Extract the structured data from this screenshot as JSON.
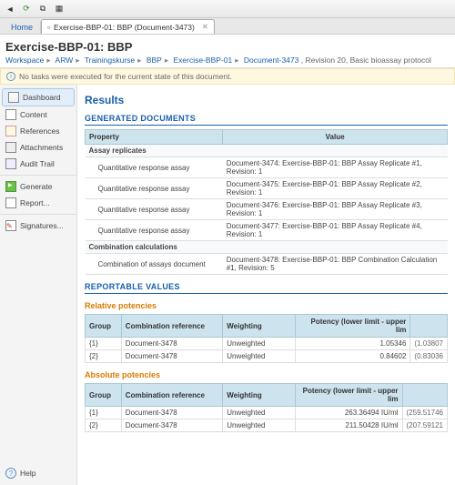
{
  "toolbar": {
    "home_label": "Home"
  },
  "tab": {
    "label": "Exercise-BBP-01: BBP (Document-3473)"
  },
  "header": {
    "title": "Exercise-BBP-01: BBP",
    "crumbs": [
      "Workspace",
      "ARW",
      "Trainingskurse",
      "BBP",
      "Exercise-BBP-01",
      "Document-3473"
    ],
    "revision": "Revision 20, Basic bioassay protocol"
  },
  "info": {
    "msg": "No tasks were executed for the current state of this document."
  },
  "sidebar": {
    "items": [
      "Dashboard",
      "Content",
      "References",
      "Attachments",
      "Audit Trail"
    ],
    "actions": [
      "Generate",
      "Report..."
    ],
    "sign": "Signatures...",
    "help": "Help"
  },
  "results": {
    "title": "Results",
    "gen_heading": "GENERATED DOCUMENTS",
    "prop_col": "Property",
    "val_col": "Value",
    "assay_label": "Assay replicates",
    "qra_label": "Quantitative response assay",
    "qra_rows": [
      "Document-3474: Exercise-BBP-01: BBP Assay Replicate #1, Revision: 1",
      "Document-3475: Exercise-BBP-01: BBP Assay Replicate #2, Revision: 1",
      "Document-3476: Exercise-BBP-01: BBP Assay Replicate #3, Revision: 1",
      "Document-3477: Exercise-BBP-01: BBP Assay Replicate #4, Revision: 1"
    ],
    "comb_label": "Combination calculations",
    "combdoc_label": "Combination of assays document",
    "combdoc_val": "Document-3478: Exercise-BBP-01: BBP Combination Calculation #1, Revision: 5",
    "rv_heading": "REPORTABLE VALUES",
    "rel_heading": "Relative potencies",
    "abs_heading": "Absolute potencies",
    "cols": {
      "group": "Group",
      "ref": "Combination reference",
      "wt": "Weighting",
      "pot": "Potency (lower limit - upper lim"
    },
    "rel_rows": [
      {
        "g": "{1}",
        "ref": "Document-3478",
        "wt": "Unweighted",
        "pot": "1.05346",
        "ci": "(1.03807"
      },
      {
        "g": "{2}",
        "ref": "Document-3478",
        "wt": "Unweighted",
        "pot": "0.84602",
        "ci": "(0.83036"
      }
    ],
    "abs_rows": [
      {
        "g": "{1}",
        "ref": "Document-3478",
        "wt": "Unweighted",
        "pot": "263.36494 IU/ml",
        "ci": "(259.51746"
      },
      {
        "g": "{2}",
        "ref": "Document-3478",
        "wt": "Unweighted",
        "pot": "211.50428 IU/ml",
        "ci": "(207.59121"
      }
    ]
  }
}
